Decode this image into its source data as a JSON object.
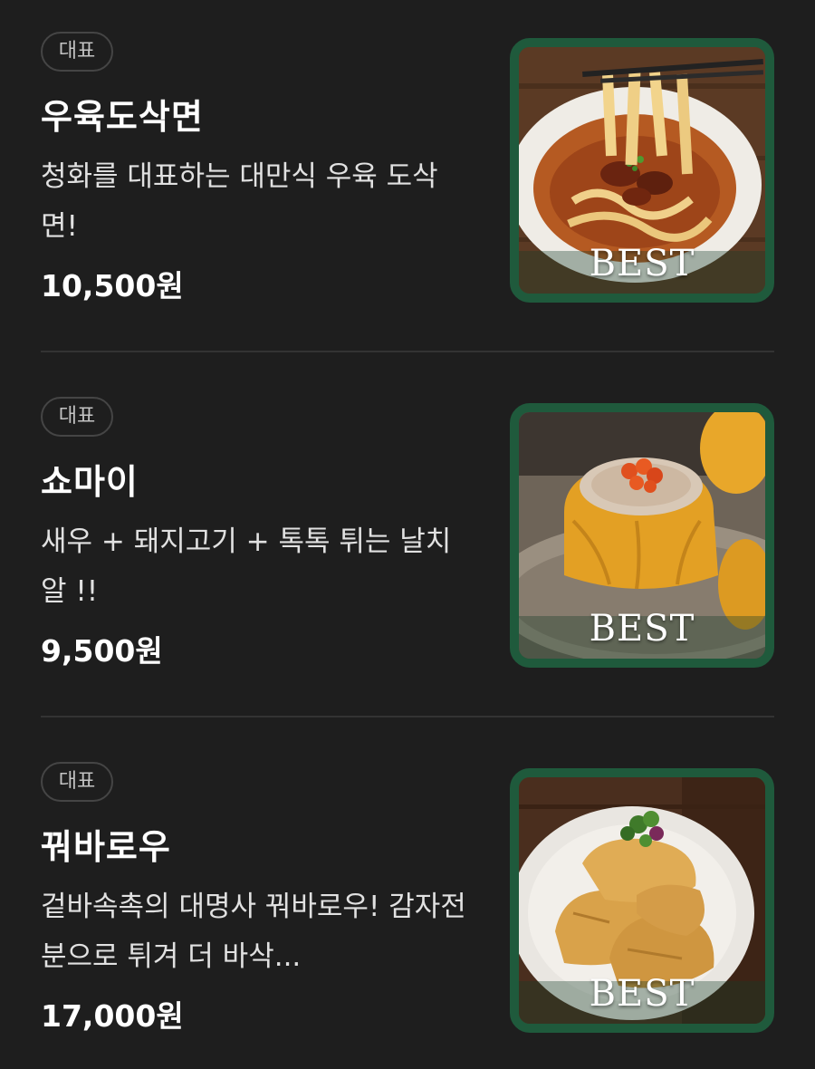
{
  "colors": {
    "background": "#1e1e1e",
    "thumb_border": "#1f5a3c",
    "divider": "#333333",
    "badge_border": "#454545"
  },
  "menu": [
    {
      "badge": "대표",
      "name": "우육도삭면",
      "description": "청화를 대표하는 대만식 우육 도삭면!",
      "price": "10,500원",
      "thumb_label": "BEST",
      "image": "beef-knife-cut-noodle-soup-photo"
    },
    {
      "badge": "대표",
      "name": "쇼마이",
      "description": "새우 + 돼지고기 + 톡톡 튀는 날치알 !!",
      "price": "9,500원",
      "thumb_label": "BEST",
      "image": "shumai-dumpling-photo"
    },
    {
      "badge": "대표",
      "name": "꿔바로우",
      "description": "겉바속촉의 대명사 꿔바로우! 감자전분으로 튀겨 더 바삭...",
      "price": "17,000원",
      "thumb_label": "BEST",
      "image": "guobaorou-fried-pork-photo"
    }
  ]
}
